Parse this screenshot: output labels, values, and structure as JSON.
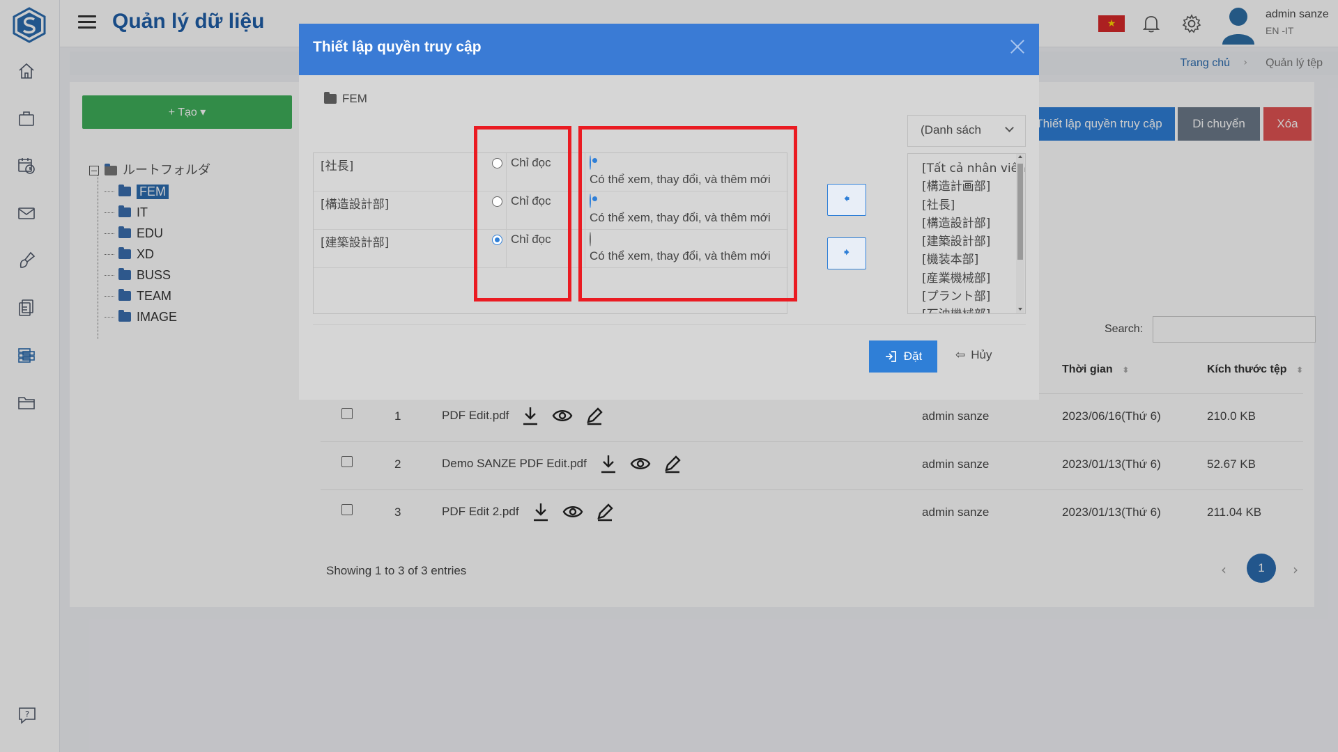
{
  "header": {
    "title": "Quản lý dữ liệu",
    "user_name": "admin sanze",
    "user_lang": "EN -IT",
    "flag_star": "★"
  },
  "breadcrumb": {
    "home": "Trang chủ",
    "separator": "›",
    "current": "Quản lý tệp"
  },
  "toolbar": {
    "create_label": "+ Tạo ▾",
    "set_permission_label": "Thiết lập quyền truy cập",
    "move_label": "Di chuyển",
    "delete_label": "Xóa"
  },
  "tree": {
    "root_label": "ルートフォルダ",
    "folders": [
      "FEM",
      "IT",
      "EDU",
      "XD",
      "BUSS",
      "TEAM",
      "IMAGE"
    ],
    "selected": "FEM"
  },
  "table": {
    "search_label": "Search:",
    "search_value": "",
    "columns": {
      "time": "Thời gian",
      "size": "Kích thước tệp",
      "sort_icon": "⬍"
    },
    "rows": [
      {
        "num": "1",
        "name": "PDF Edit.pdf",
        "owner": "admin sanze",
        "date": "2023/06/16(Thứ 6)",
        "size": "210.0 KB"
      },
      {
        "num": "2",
        "name": "Demo SANZE PDF Edit.pdf",
        "owner": "admin sanze",
        "date": "2023/01/13(Thứ 6)",
        "size": "52.67 KB"
      },
      {
        "num": "3",
        "name": "PDF Edit 2.pdf",
        "owner": "admin sanze",
        "date": "2023/01/13(Thứ 6)",
        "size": "211.04 KB"
      }
    ],
    "showing": "Showing 1 to 3 of 3 entries",
    "pagination": {
      "prev": "‹",
      "current": "1",
      "next": "›"
    }
  },
  "modal": {
    "title": "Thiết lập quyền truy cập",
    "folder": "FEM",
    "permissions": [
      {
        "group": "[社長]",
        "read_only": "Chỉ đọc",
        "full_access": "Có thể xem, thay đổi, và thêm mới",
        "selected": "full"
      },
      {
        "group": "[構造設計部]",
        "read_only": "Chỉ đọc",
        "full_access": "Có thể xem, thay đổi, và thêm mới",
        "selected": "full"
      },
      {
        "group": "[建築設計部]",
        "read_only": "Chỉ đọc",
        "full_access": "Có thể xem, thay đổi, và thêm mới",
        "selected": "read"
      }
    ],
    "arrow_left": "🠸",
    "arrow_right": "🠺",
    "list_select": "(Danh sách",
    "list_items": [
      "[Tất cả nhân viên",
      "[構造計画部]",
      "[社長]",
      "[構造設計部]",
      "[建築設計部]",
      "[機装本部]",
      "[産業機械部]",
      "[プラント部]",
      "[石油機械部]"
    ],
    "submit_label": "Đặt",
    "cancel_label": "Hủy",
    "cancel_icon": "⇦"
  },
  "colors": {
    "accent": "#2f7fd7",
    "highlight": "#ea1b22",
    "create": "#3fb05a",
    "danger": "#e15353"
  }
}
